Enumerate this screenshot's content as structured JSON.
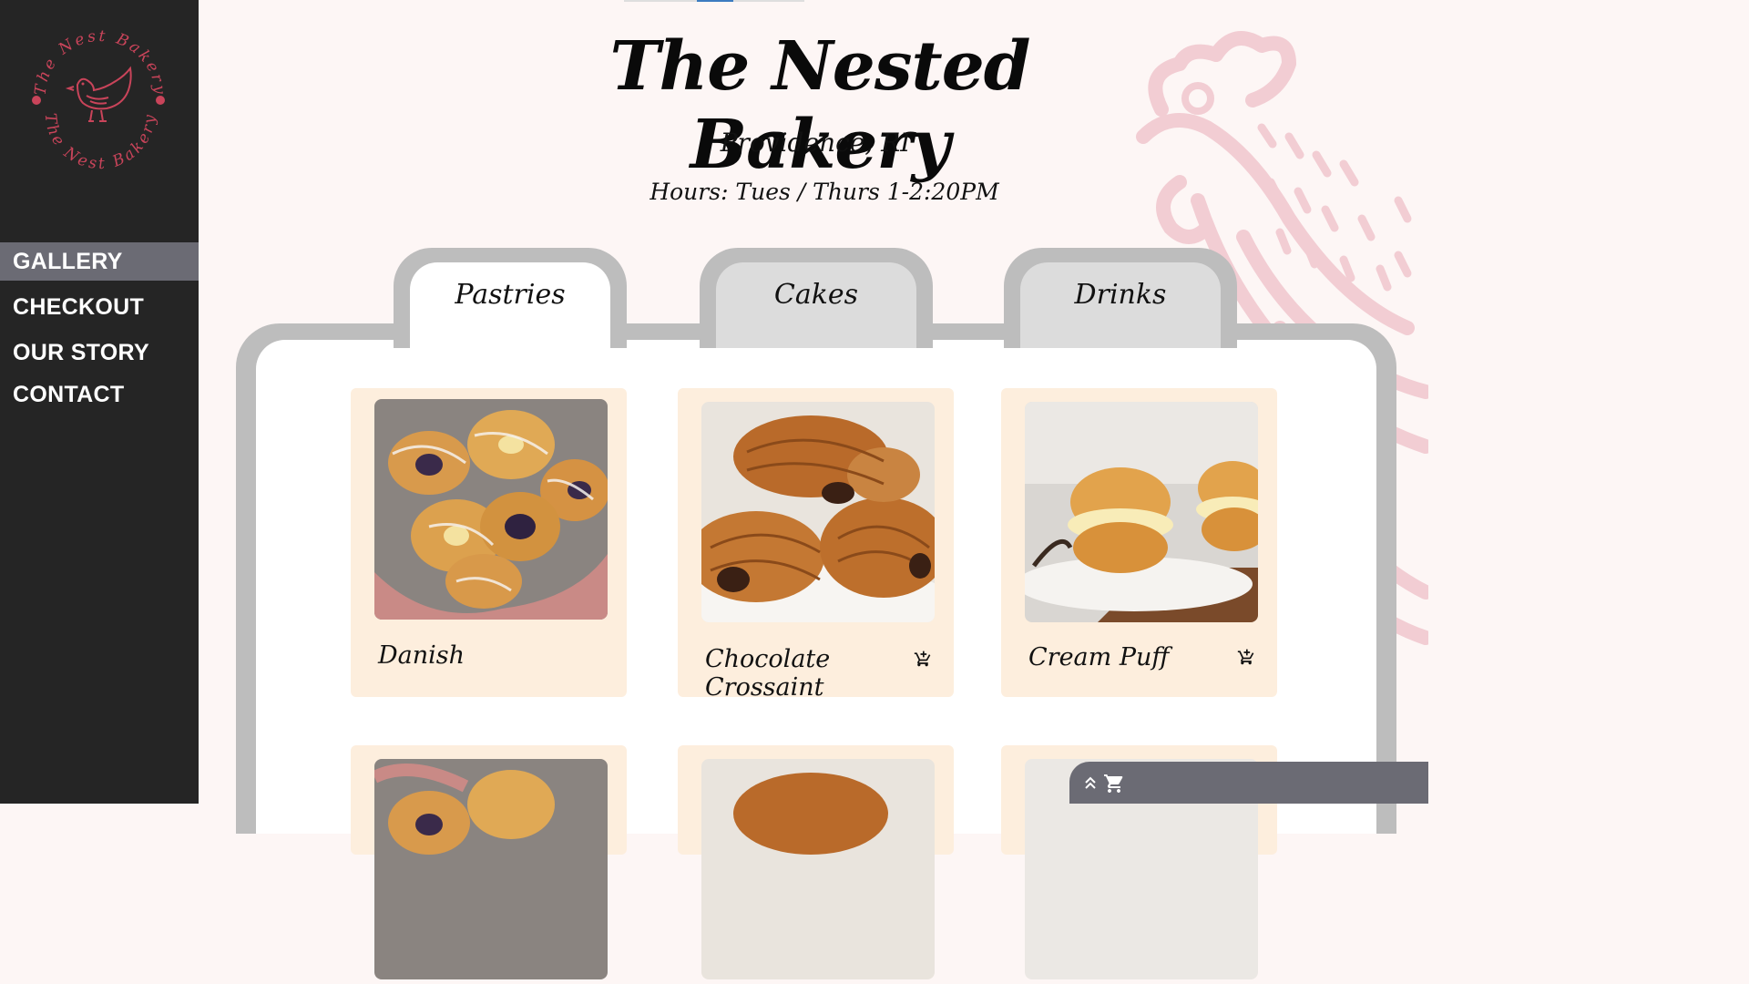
{
  "brand": {
    "logo_text": "The Nest Bakery"
  },
  "nav": [
    {
      "label": "GALLERY",
      "active": true
    },
    {
      "label": "CHECKOUT",
      "active": false
    },
    {
      "label": "OUR STORY",
      "active": false
    },
    {
      "label": "CONTACT",
      "active": false
    }
  ],
  "header": {
    "title": "The Nested Bakery",
    "location": "Providence, RI",
    "hours": "Hours: Tues / Thurs 1-2:20PM"
  },
  "tabs": [
    {
      "label": "Pastries",
      "active": true
    },
    {
      "label": "Cakes",
      "active": false
    },
    {
      "label": "Drinks",
      "active": false
    }
  ],
  "products": [
    {
      "name": "Danish",
      "icon": "add-to-cart-icon",
      "show_cart": false
    },
    {
      "name": "Chocolate Crossaint",
      "icon": "add-to-cart-icon",
      "show_cart": true
    },
    {
      "name": "Cream Puff",
      "icon": "add-to-cart-icon",
      "show_cart": true
    }
  ],
  "cart_bar": {
    "icons": [
      "expand-up-icon",
      "shopping-cart-icon"
    ]
  },
  "colors": {
    "sidebar": "#252525",
    "nav_active": "#6b6b74",
    "accent_pink": "#c9445a",
    "card_bg": "#fdeedd",
    "tab_frame": "#bdbdbd"
  }
}
